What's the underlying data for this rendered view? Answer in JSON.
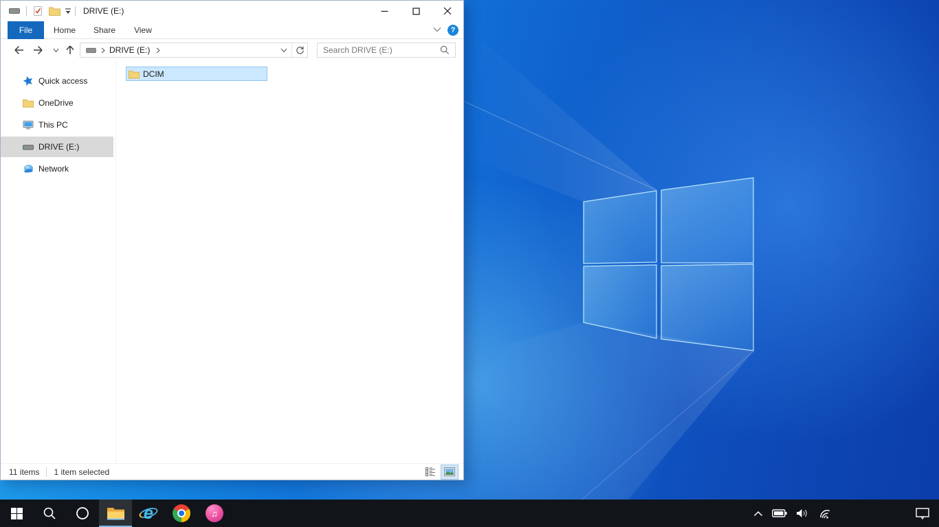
{
  "window": {
    "title": "DRIVE (E:)",
    "controls": {
      "minimize": "minimize",
      "maximize": "maximize",
      "close": "close"
    }
  },
  "quick_access_toolbar": {
    "icons": [
      "drive-icon",
      "properties-icon",
      "new-folder-icon"
    ],
    "customize": "customize-quick-access-dropdown"
  },
  "ribbon": {
    "tabs": [
      {
        "label": "File",
        "active": true
      },
      {
        "label": "Home",
        "active": false
      },
      {
        "label": "Share",
        "active": false
      },
      {
        "label": "View",
        "active": false
      }
    ],
    "help_glyph": "?",
    "file_tab_color": "#1569bd",
    "help_color": "#1c84d8"
  },
  "navigation": {
    "back": "back",
    "forward": "forward",
    "recent_locations": "recent-locations-dropdown",
    "up": "up",
    "breadcrumb_root_icon": "drive-icon",
    "breadcrumb": "DRIVE (E:)",
    "address_dropdown": "previous-locations-dropdown",
    "refresh": "refresh",
    "search_placeholder": "Search DRIVE (E:)"
  },
  "sidebar": {
    "items": [
      {
        "label": "Quick access",
        "icon": "star-icon",
        "selected": false
      },
      {
        "label": "OneDrive",
        "icon": "folder-icon",
        "selected": false
      },
      {
        "label": "This PC",
        "icon": "monitor-icon",
        "selected": false
      },
      {
        "label": "DRIVE (E:)",
        "icon": "drive-icon",
        "selected": true
      },
      {
        "label": "Network",
        "icon": "network-icon",
        "selected": false
      }
    ]
  },
  "files": [
    {
      "name": "DCIM",
      "icon": "folder-icon",
      "selected": true
    }
  ],
  "statusbar": {
    "items_count": "11 items",
    "selection": "1 item selected",
    "view_buttons": [
      "details-view",
      "large-thumbnails-view"
    ],
    "active_view": "large-thumbnails-view"
  },
  "taskbar": {
    "buttons": [
      {
        "name": "start",
        "active": false
      },
      {
        "name": "search",
        "active": false
      },
      {
        "name": "cortana",
        "active": false
      },
      {
        "name": "file-explorer",
        "active": true
      },
      {
        "name": "internet-explorer",
        "active": false
      },
      {
        "name": "chrome",
        "active": false
      },
      {
        "name": "itunes",
        "active": false
      }
    ],
    "tray_icons": [
      "hidden-icons-chevron",
      "battery",
      "volume",
      "wifi"
    ],
    "action_center": "action-center",
    "active_underline_color": "#79b8eb"
  },
  "icons": {
    "music_note": "♫",
    "ie_letter": "e"
  },
  "colors": {
    "selection_bg": "#cce8ff",
    "selection_border": "#8fc8f2",
    "sidebar_selected_bg": "#d9d9d9",
    "taskbar_bg": "#111418",
    "wallpaper_light": "#27a6ee",
    "wallpaper_dark": "#0b3da9"
  }
}
